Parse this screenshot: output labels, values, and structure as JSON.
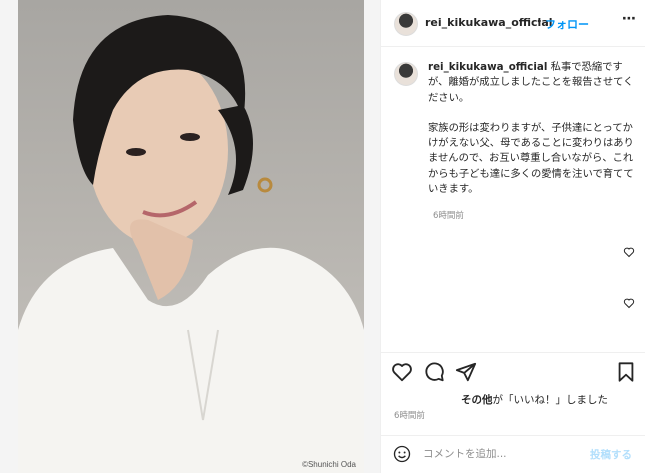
{
  "photo": {
    "credit": "©Shunichi Oda"
  },
  "header": {
    "username": "rei_kikukawa_official",
    "separator": "•",
    "follow_label": "フォロー",
    "more_label": "⋯"
  },
  "caption": {
    "username": "rei_kikukawa_official",
    "para1": "私事で恐縮ですが、離婚が成立しましたことを報告させてください。",
    "para2": "家族の形は変わりますが、子供達にとってかけがえない父、母であることに変わりはありませんので、お互い尊重し合いながら、これからも子ども達に多くの愛情を注いで育てていきます。",
    "time": "6時間前"
  },
  "likes": {
    "who": "その他",
    "text": "が「いいね！」しました"
  },
  "post_time": "6時間前",
  "comment": {
    "placeholder": "コメントを追加...",
    "post_label": "投稿する"
  },
  "colors": {
    "follow": "#0095f6",
    "post_disabled": "#b2dffc",
    "muted": "#8e8e8e"
  },
  "icons": [
    "heart-icon",
    "comment-icon",
    "share-icon",
    "bookmark-icon",
    "emoji-icon",
    "more-icon"
  ]
}
